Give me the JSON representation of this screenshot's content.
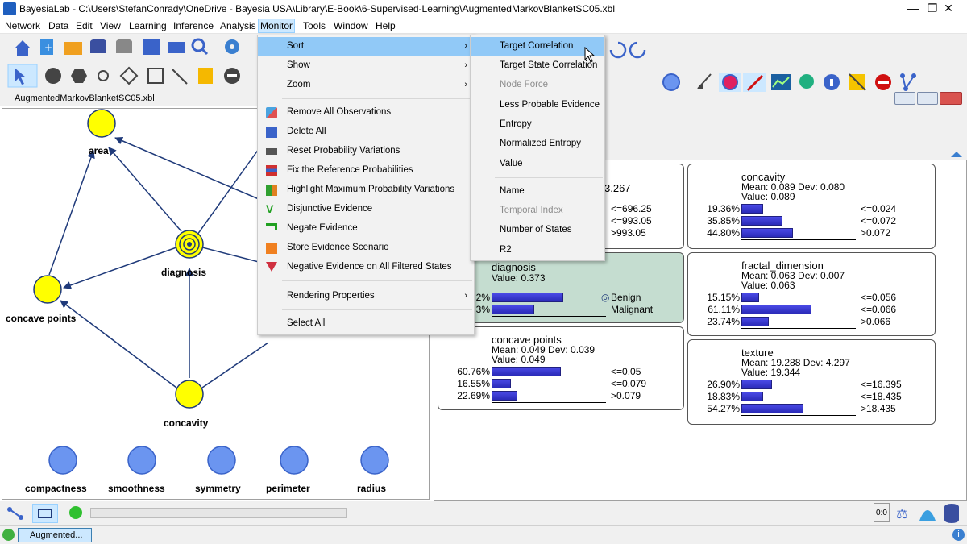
{
  "window": {
    "title": "BayesiaLab - C:\\Users\\StefanConrady\\OneDrive - Bayesia USA\\Library\\E-Book\\6-Supervised-Learning\\AugmentedMarkovBlanketSC05.xbl",
    "minimize": "—",
    "maximize": "❐",
    "close": "✕"
  },
  "menubar": [
    "Network",
    "Data",
    "Edit",
    "View",
    "Learning",
    "Inference",
    "Analysis",
    "Monitor",
    "Tools",
    "Window",
    "Help"
  ],
  "document_tab": "AugmentedMarkovBlanketSC05.xbl",
  "monitor_menu": {
    "items": [
      {
        "label": "Sort",
        "submenu": true
      },
      {
        "label": "Show",
        "submenu": true
      },
      {
        "label": "Zoom",
        "submenu": true
      },
      {
        "label": "Remove All Observations"
      },
      {
        "label": "Delete All"
      },
      {
        "label": "Reset Probability Variations"
      },
      {
        "label": "Fix the Reference Probabilities"
      },
      {
        "label": "Highlight Maximum Probability Variations"
      },
      {
        "label": "Disjunctive Evidence"
      },
      {
        "label": "Negate Evidence"
      },
      {
        "label": "Store Evidence Scenario"
      },
      {
        "label": "Negative Evidence on All Filtered States"
      },
      {
        "label": "Rendering Properties",
        "submenu": true
      },
      {
        "label": "Select All"
      }
    ]
  },
  "sort_submenu": {
    "items": [
      {
        "label": "Target Correlation"
      },
      {
        "label": "Target State Correlation"
      },
      {
        "label": "Node Force",
        "disabled": true
      },
      {
        "label": "Less Probable Evidence"
      },
      {
        "label": "Entropy"
      },
      {
        "label": "Normalized Entropy"
      },
      {
        "label": "Value"
      },
      {
        "label": "Name"
      },
      {
        "label": "Temporal Index",
        "disabled": true
      },
      {
        "label": "Number of States"
      },
      {
        "label": "R2"
      }
    ]
  },
  "graph": {
    "nodes": {
      "area": "area",
      "diagnosis": "diagnosis",
      "concave_points": "concave points",
      "concavity": "concavity",
      "compactness": "compactness",
      "smoothness": "smoothness",
      "symmetry": "symmetry",
      "perimeter": "perimeter",
      "radius": "radius"
    }
  },
  "monitors": {
    "area_partial": {
      "value_tail": "3.267",
      "states": [
        "<=696.25",
        "<=993.05",
        ">993.05"
      ]
    },
    "diagnosis": {
      "name": "diagnosis",
      "value": "Value: 0.373",
      "rows": [
        {
          "pct": "2%",
          "fraction": 0.627,
          "state": "Benign"
        },
        {
          "pct": "3%",
          "fraction": 0.373,
          "state": "Malignant"
        }
      ]
    },
    "concave_points": {
      "name": "concave points",
      "stats": "Mean: 0.049 Dev: 0.039",
      "value": "Value: 0.049",
      "rows": [
        {
          "pct": "60.76%",
          "fraction": 0.6076,
          "state": "<=0.05"
        },
        {
          "pct": "16.55%",
          "fraction": 0.1655,
          "state": "<=0.079"
        },
        {
          "pct": "22.69%",
          "fraction": 0.2269,
          "state": ">0.079"
        }
      ]
    },
    "concavity": {
      "name": "concavity",
      "stats": "Mean: 0.089 Dev: 0.080",
      "value": "Value: 0.089",
      "rows": [
        {
          "pct": "19.36%",
          "fraction": 0.1936,
          "state": "<=0.024"
        },
        {
          "pct": "35.85%",
          "fraction": 0.3585,
          "state": "<=0.072"
        },
        {
          "pct": "44.80%",
          "fraction": 0.448,
          "state": ">0.072"
        }
      ]
    },
    "fractal_dimension": {
      "name": "fractal_dimension",
      "stats": "Mean: 0.063 Dev: 0.007",
      "value": "Value: 0.063",
      "rows": [
        {
          "pct": "15.15%",
          "fraction": 0.1515,
          "state": "<=0.056"
        },
        {
          "pct": "61.11%",
          "fraction": 0.6111,
          "state": "<=0.066"
        },
        {
          "pct": "23.74%",
          "fraction": 0.2374,
          "state": ">0.066"
        }
      ]
    },
    "texture": {
      "name": "texture",
      "stats": "Mean: 19.288 Dev: 4.297",
      "value": "Value: 19.344",
      "rows": [
        {
          "pct": "26.90%",
          "fraction": 0.269,
          "state": "<=16.395"
        },
        {
          "pct": "18.83%",
          "fraction": 0.1883,
          "state": "<=18.435"
        },
        {
          "pct": "54.27%",
          "fraction": 0.5427,
          "state": ">18.435"
        }
      ]
    }
  },
  "status": {
    "tab": "Augmented...",
    "zoom": "0:0"
  },
  "colors": {
    "node_yellow": "#ffff00",
    "node_blue": "#6b95f0",
    "menu_highlight": "#91c9f7",
    "bar_blue": "#3a3ad0",
    "target_monitor_bg": "#c5ddd0"
  }
}
